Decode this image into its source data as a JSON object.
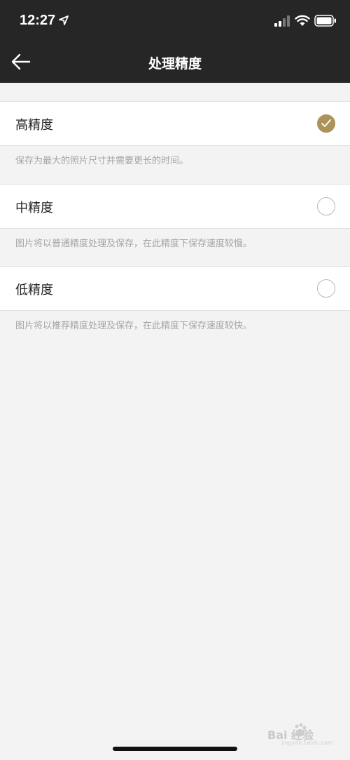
{
  "status_bar": {
    "time": "12:27"
  },
  "header": {
    "title": "处理精度"
  },
  "options": [
    {
      "label": "高精度",
      "selected": true,
      "description": "保存为最大的照片尺寸并需要更长的时间。"
    },
    {
      "label": "中精度",
      "selected": false,
      "description": "图片将以普通精度处理及保存，在此精度下保存速度较慢。"
    },
    {
      "label": "低精度",
      "selected": false,
      "description": "图片将以推荐精度处理及保存，在此精度下保存速度较快。"
    }
  ],
  "watermark": {
    "text": "Bai 经验",
    "subtext": "jingyan.baidu.com"
  },
  "colors": {
    "header_bg": "#262626",
    "accent": "#ab935a",
    "page_bg": "#f3f3f3"
  }
}
